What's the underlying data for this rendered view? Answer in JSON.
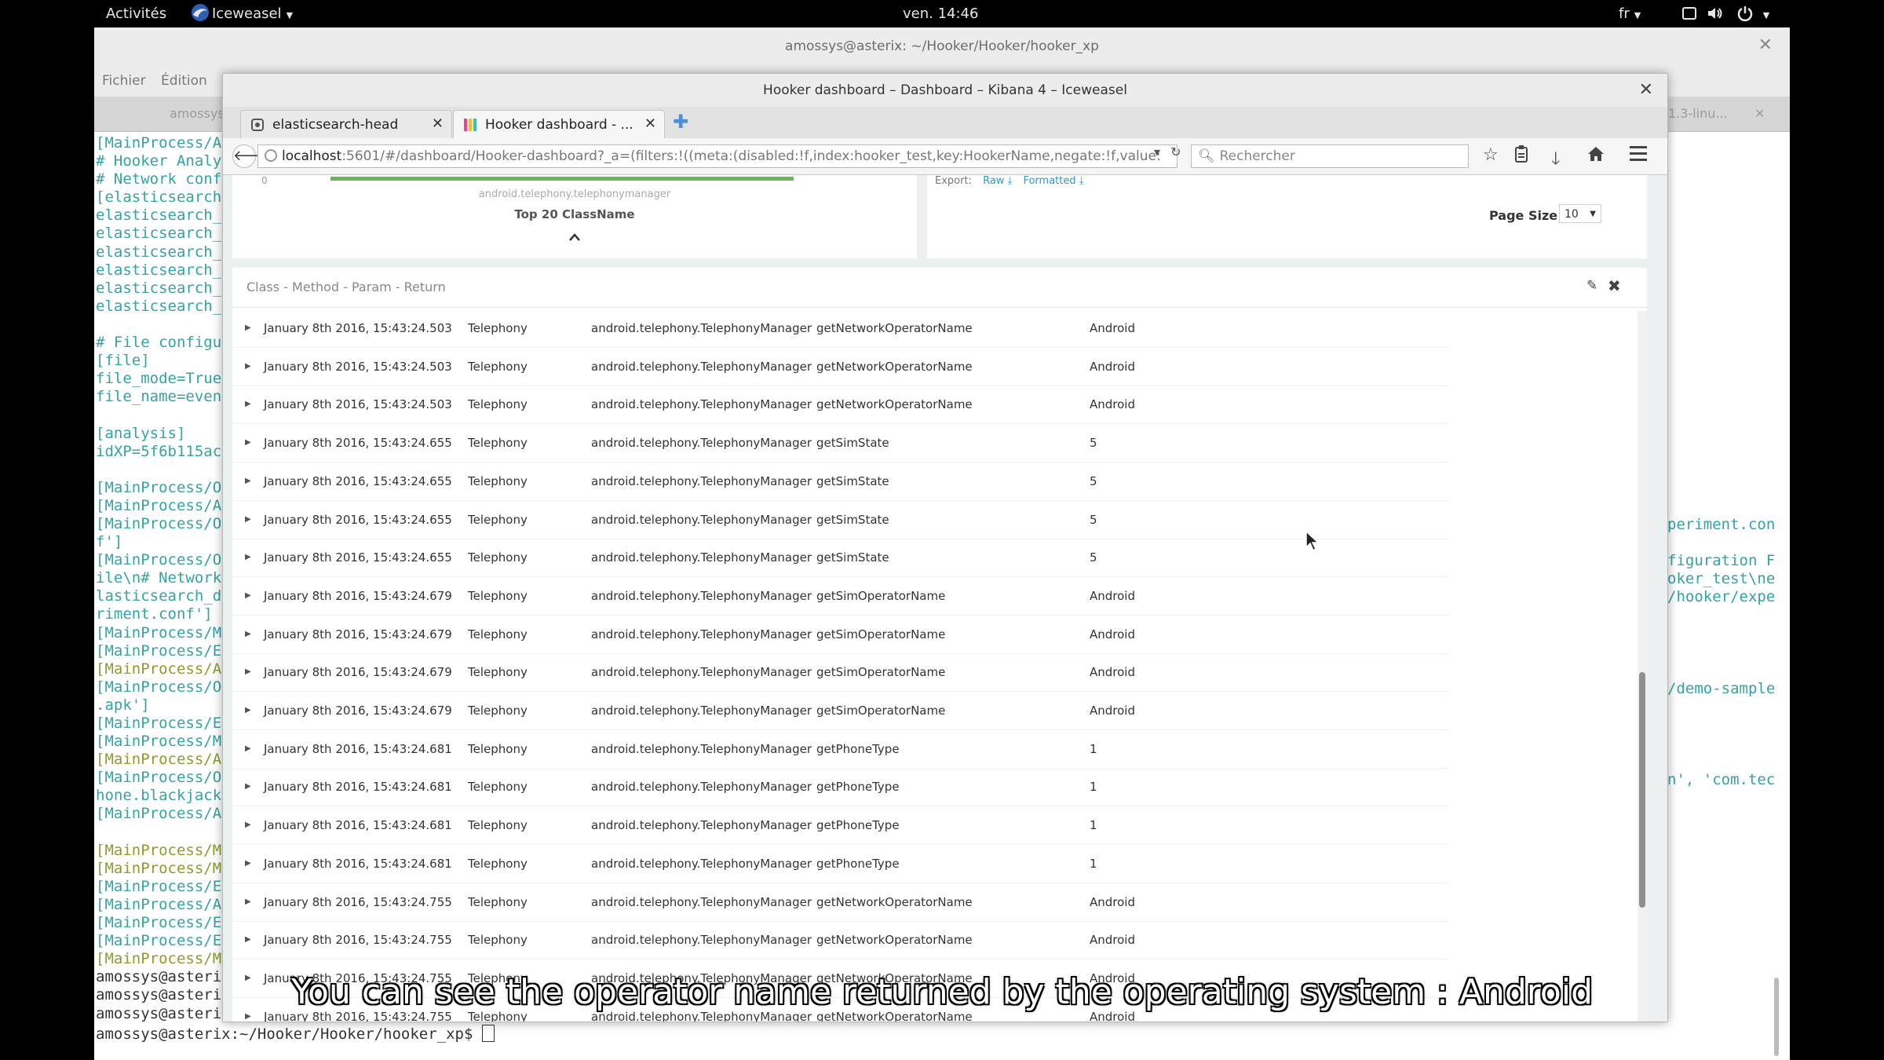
{
  "topbar": {
    "activities": "Activités",
    "app_name": "Iceweasel",
    "clock": "ven. 14:46",
    "lang": "fr"
  },
  "terminal": {
    "title": "amossys@asterix: ~/Hooker/Hooker/hooker_xp",
    "menu": [
      "Fichier",
      "Édition"
    ],
    "tabs": [
      "amossys",
      "1.3-linu..."
    ],
    "lines": [
      {
        "t": "[MainProcess/A",
        "c": "lw"
      },
      {
        "t": "# Hooker Analy",
        "c": "lw"
      },
      {
        "t": "# Network conf",
        "c": "lw"
      },
      {
        "t": "[elasticsearch",
        "c": "lw"
      },
      {
        "t": "elasticsearch_",
        "c": "lw"
      },
      {
        "t": "elasticsearch_",
        "c": "lw"
      },
      {
        "t": "elasticsearch_",
        "c": "lw"
      },
      {
        "t": "elasticsearch_",
        "c": "lw"
      },
      {
        "t": "elasticsearch_",
        "c": "lw"
      },
      {
        "t": "elasticsearch_",
        "c": "lw"
      },
      {
        "t": "",
        "c": "lw"
      },
      {
        "t": "# File configu",
        "c": "lw"
      },
      {
        "t": "[file]",
        "c": "lw"
      },
      {
        "t": "file_mode=True",
        "c": "lw"
      },
      {
        "t": "file_name=even",
        "c": "lw"
      },
      {
        "t": "",
        "c": "lw"
      },
      {
        "t": "[analysis]",
        "c": "lw"
      },
      {
        "t": "idXP=5f6b115ac",
        "c": "lw"
      },
      {
        "t": "",
        "c": "lw"
      },
      {
        "t": "[MainProcess/O",
        "c": "lw"
      },
      {
        "t": "[MainProcess/A",
        "c": "lw"
      },
      {
        "t": "[MainProcess/O",
        "c": "lw"
      },
      {
        "t": "f']",
        "c": "lw"
      },
      {
        "t": "[MainProcess/O",
        "c": "lw"
      },
      {
        "t": "ile\\n# Network",
        "c": "lw"
      },
      {
        "t": "lasticsearch_d",
        "c": "lw"
      },
      {
        "t": "riment.conf']",
        "c": "lw"
      },
      {
        "t": "[MainProcess/M",
        "c": "lw"
      },
      {
        "t": "[MainProcess/E",
        "c": "lw"
      },
      {
        "t": "[MainProcess/A",
        "c": "lg"
      },
      {
        "t": "[MainProcess/O",
        "c": "lw"
      },
      {
        "t": ".apk']",
        "c": "lw"
      },
      {
        "t": "[MainProcess/E",
        "c": "lw"
      },
      {
        "t": "[MainProcess/M",
        "c": "lw"
      },
      {
        "t": "[MainProcess/A",
        "c": "lg"
      },
      {
        "t": "[MainProcess/O",
        "c": "lw"
      },
      {
        "t": "hone.blackjack",
        "c": "lw"
      },
      {
        "t": "[MainProcess/A",
        "c": "lw"
      },
      {
        "t": "",
        "c": "lw"
      },
      {
        "t": "[MainProcess/M",
        "c": "lg"
      },
      {
        "t": "[MainProcess/M",
        "c": "lg"
      },
      {
        "t": "[MainProcess/E",
        "c": "lw"
      },
      {
        "t": "[MainProcess/A",
        "c": "lw"
      },
      {
        "t": "[MainProcess/E",
        "c": "lw"
      },
      {
        "t": "[MainProcess/E",
        "c": "lw"
      },
      {
        "t": "[MainProcess/M",
        "c": "lg"
      },
      {
        "t": "amossys@asteri",
        "c": "lb"
      },
      {
        "t": "amossys@asteri",
        "c": "lb"
      },
      {
        "t": "amossys@asteri",
        "c": "lb"
      }
    ],
    "right_fragments": [
      "periment.con",
      "figuration F",
      "oker_test\\ne",
      "/hooker/expe",
      "/demo-sample",
      "n', 'com.tec"
    ],
    "prompt": "amossys@asterix:~/Hooker/Hooker/hooker_xp$ "
  },
  "browser": {
    "window_title": "Hooker dashboard – Dashboard – Kibana 4 – Iceweasel",
    "tabs": [
      {
        "label": "elasticsearch-head"
      },
      {
        "label": "Hooker dashboard - ..."
      }
    ],
    "url_host": "localhost",
    "url_rest": ":5601/#/dashboard/Hooker-dashboard?_a=(filters:!((meta:(disabled:!f,index:hooker_test,key:HookerName,negate:!f,value:",
    "search_placeholder": "Rechercher"
  },
  "dashboard": {
    "top_left": {
      "bar_axis_zero": "0",
      "bar_label": "android.telephony.telephonymanager",
      "title": "Top 20 ClassName"
    },
    "top_right": {
      "export_label": "Export:",
      "export_raw": "Raw",
      "export_formatted": "Formatted",
      "page_size_label": "Page Size",
      "page_size_value": "10"
    },
    "table_panel": {
      "title": "Class - Method - Param - Return",
      "rows": [
        {
          "time": "January 8th 2016, 15:43:24.503",
          "category": "Telephony",
          "class": "android.telephony.TelephonyManager",
          "method": "getNetworkOperatorName",
          "ret": "Android"
        },
        {
          "time": "January 8th 2016, 15:43:24.503",
          "category": "Telephony",
          "class": "android.telephony.TelephonyManager",
          "method": "getNetworkOperatorName",
          "ret": "Android"
        },
        {
          "time": "January 8th 2016, 15:43:24.503",
          "category": "Telephony",
          "class": "android.telephony.TelephonyManager",
          "method": "getNetworkOperatorName",
          "ret": "Android"
        },
        {
          "time": "January 8th 2016, 15:43:24.655",
          "category": "Telephony",
          "class": "android.telephony.TelephonyManager",
          "method": "getSimState",
          "ret": "5"
        },
        {
          "time": "January 8th 2016, 15:43:24.655",
          "category": "Telephony",
          "class": "android.telephony.TelephonyManager",
          "method": "getSimState",
          "ret": "5"
        },
        {
          "time": "January 8th 2016, 15:43:24.655",
          "category": "Telephony",
          "class": "android.telephony.TelephonyManager",
          "method": "getSimState",
          "ret": "5"
        },
        {
          "time": "January 8th 2016, 15:43:24.655",
          "category": "Telephony",
          "class": "android.telephony.TelephonyManager",
          "method": "getSimState",
          "ret": "5"
        },
        {
          "time": "January 8th 2016, 15:43:24.679",
          "category": "Telephony",
          "class": "android.telephony.TelephonyManager",
          "method": "getSimOperatorName",
          "ret": "Android"
        },
        {
          "time": "January 8th 2016, 15:43:24.679",
          "category": "Telephony",
          "class": "android.telephony.TelephonyManager",
          "method": "getSimOperatorName",
          "ret": "Android"
        },
        {
          "time": "January 8th 2016, 15:43:24.679",
          "category": "Telephony",
          "class": "android.telephony.TelephonyManager",
          "method": "getSimOperatorName",
          "ret": "Android"
        },
        {
          "time": "January 8th 2016, 15:43:24.679",
          "category": "Telephony",
          "class": "android.telephony.TelephonyManager",
          "method": "getSimOperatorName",
          "ret": "Android"
        },
        {
          "time": "January 8th 2016, 15:43:24.681",
          "category": "Telephony",
          "class": "android.telephony.TelephonyManager",
          "method": "getPhoneType",
          "ret": "1"
        },
        {
          "time": "January 8th 2016, 15:43:24.681",
          "category": "Telephony",
          "class": "android.telephony.TelephonyManager",
          "method": "getPhoneType",
          "ret": "1"
        },
        {
          "time": "January 8th 2016, 15:43:24.681",
          "category": "Telephony",
          "class": "android.telephony.TelephonyManager",
          "method": "getPhoneType",
          "ret": "1"
        },
        {
          "time": "January 8th 2016, 15:43:24.681",
          "category": "Telephony",
          "class": "android.telephony.TelephonyManager",
          "method": "getPhoneType",
          "ret": "1"
        },
        {
          "time": "January 8th 2016, 15:43:24.755",
          "category": "Telephony",
          "class": "android.telephony.TelephonyManager",
          "method": "getNetworkOperatorName",
          "ret": "Android"
        },
        {
          "time": "January 8th 2016, 15:43:24.755",
          "category": "Telephony",
          "class": "android.telephony.TelephonyManager",
          "method": "getNetworkOperatorName",
          "ret": "Android"
        },
        {
          "time": "January 8th 2016, 15:43:24.755",
          "category": "Telephony",
          "class": "android.telephony.TelephonyManager",
          "method": "getNetworkOperatorName",
          "ret": "Android"
        },
        {
          "time": "January 8th 2016, 15:43:24.755",
          "category": "Telephony",
          "class": "android.telephony.TelephonyManager",
          "method": "getNetworkOperatorName",
          "ret": "Android"
        }
      ]
    }
  },
  "subtitle": "You can see the operator name returned by the operating system : Android",
  "colors": {
    "kibana_bar": "#6ab556",
    "link": "#2f99c1",
    "terminal_text": "#35a3a3",
    "terminal_green": "#8f9a2f"
  },
  "icons": [
    "user-menu-icon",
    "iceweasel-icon",
    "screen-icon",
    "volume-icon",
    "power-icon",
    "back-arrow-icon",
    "lock-icon",
    "reload-icon",
    "search-icon",
    "bookmark-star-icon",
    "clipboard-icon",
    "download-icon",
    "home-icon",
    "hamburger-menu-icon",
    "pencil-icon",
    "close-icon",
    "mouse-pointer-icon"
  ]
}
